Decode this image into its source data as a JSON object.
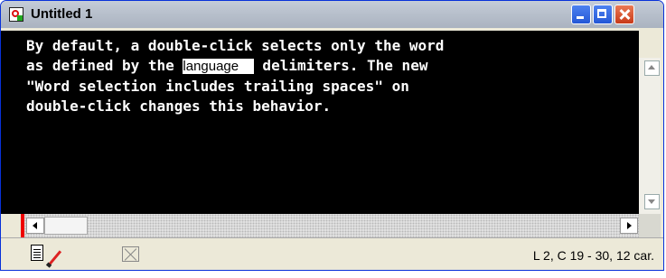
{
  "window": {
    "title": "Untitled 1"
  },
  "editor": {
    "line1": "By default, a double-click selects only the word",
    "line2_before": "as defined by the ",
    "line2_selected": "language    ",
    "line2_after": " delimiters. The new",
    "line3": "\"Word selection includes trailing spaces\" on",
    "line4": "double-click changes this behavior."
  },
  "statusbar": {
    "position_text": "L 2,  C 19 - 30, 12 car."
  },
  "icons": {
    "title": "document-window-icon",
    "minimize": "minimize-icon",
    "maximize": "maximize-icon",
    "close": "close-icon",
    "doc": "document-icon",
    "pen": "pen-icon",
    "x": "disabled-x-icon"
  },
  "colors": {
    "editor_bg": "#000000",
    "editor_text": "#ffffff",
    "selection_bg": "#ffffff",
    "titlebar": "#b8c0cc",
    "margin_marker": "#e00000"
  }
}
